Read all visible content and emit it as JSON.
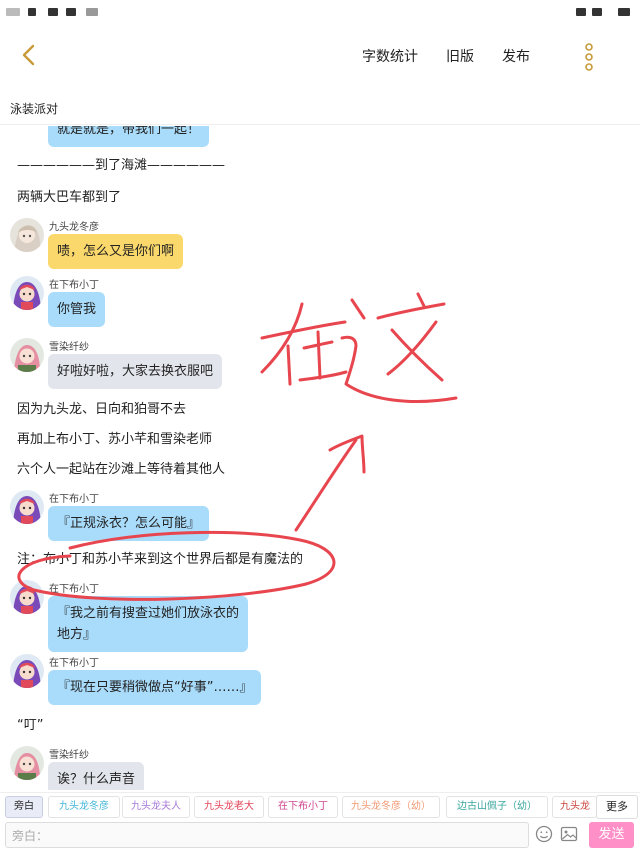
{
  "status_bar": {},
  "nav": {
    "word_count": "字数统计",
    "old_version": "旧版",
    "publish": "发布"
  },
  "doc_title": "泳装派对",
  "chat": {
    "top_partial": "就是就是，带我们一起！",
    "scene_break": "——————到了海滩——————",
    "narration1": "两辆大巴车都到了",
    "m1_speaker": "九头龙冬彦",
    "m1_text": "啧，怎么又是你们啊",
    "m2_speaker": "在下布小丁",
    "m2_text": "你管我",
    "m3_speaker": "雪染纤纱",
    "m3_text": "好啦好啦，大家去换衣服吧",
    "narration2": "因为九头龙、日向和狛哥不去",
    "narration3": "再加上布小丁、苏小芊和雪染老师",
    "narration4": "六个人一起站在沙滩上等待着其他人",
    "m4_speaker": "在下布小丁",
    "m4_text": "『正规泳衣？怎么可能』",
    "note": "注：布小丁和苏小芊来到这个世界后都是有魔法的",
    "m5_speaker": "在下布小丁",
    "m5_line1": "『我之前有搜查过她们放泳衣的",
    "m5_line2": "地方』",
    "m6_speaker": "在下布小丁",
    "m6_text": "『现在只要稍微做点“好事”……』",
    "narration5": "“叮”",
    "m7_speaker": "雪染纤纱",
    "m7_text": "诶？什么声音"
  },
  "annotation": {
    "handwriting": "在这",
    "color": "#e8464f"
  },
  "characters": [
    {
      "label": "旁白",
      "color": "#222222"
    },
    {
      "label": "九头龙冬彦",
      "color": "#44b6d8"
    },
    {
      "label": "九头龙夫人",
      "color": "#a77ad6"
    },
    {
      "label": "九头龙老大",
      "color": "#e0455a"
    },
    {
      "label": "在下布小丁",
      "color": "#d0458e"
    },
    {
      "label": "九头龙冬彦（幼）",
      "color": "#f29a73"
    },
    {
      "label": "边古山佩子（幼）",
      "color": "#3aa69d"
    },
    {
      "label": "九头龙",
      "color": "#c8453d"
    }
  ],
  "more_label": "更多",
  "input": {
    "placeholder": "旁白：",
    "emoji_icon": "emoji-icon",
    "image_icon": "image-icon",
    "send_label": "发送"
  },
  "colors": {
    "bubble_blue": "#a9dcfb",
    "bubble_yellow": "#fbd86b",
    "bubble_gray": "#e2e6ec",
    "send_pink": "#ff8fc7",
    "back_arrow": "#c79a3a"
  }
}
